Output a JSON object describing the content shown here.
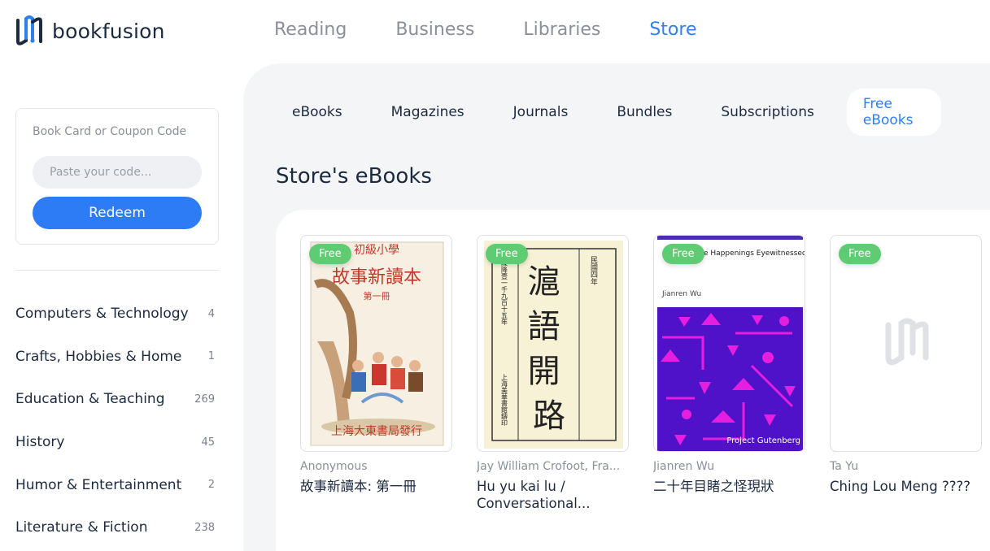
{
  "brand": {
    "name": "bookfusion"
  },
  "header": {
    "nav": [
      {
        "label": "Reading",
        "active": false
      },
      {
        "label": "Business",
        "active": false
      },
      {
        "label": "Libraries",
        "active": false
      },
      {
        "label": "Store",
        "active": true
      }
    ]
  },
  "sidebar": {
    "coupon": {
      "title": "Book Card or Coupon Code",
      "placeholder": "Paste your code...",
      "button": "Redeem"
    },
    "categories": [
      {
        "label": "Computers & Technology",
        "count": "4"
      },
      {
        "label": "Crafts, Hobbies & Home",
        "count": "1"
      },
      {
        "label": "Education & Teaching",
        "count": "269"
      },
      {
        "label": "History",
        "count": "45"
      },
      {
        "label": "Humor & Entertainment",
        "count": "2"
      },
      {
        "label": "Literature & Fiction",
        "count": "238"
      }
    ]
  },
  "store": {
    "tabs": [
      {
        "label": "eBooks",
        "active": false
      },
      {
        "label": "Magazines",
        "active": false
      },
      {
        "label": "Journals",
        "active": false
      },
      {
        "label": "Bundles",
        "active": false
      },
      {
        "label": "Subscriptions",
        "active": false
      },
      {
        "label": "Free eBooks",
        "active": true
      }
    ],
    "section_title": "Store's eBooks",
    "books": [
      {
        "badge": "Free",
        "author": "Anonymous",
        "title": "故事新讀本: 第一冊",
        "cover_text": {
          "top": "初級小學",
          "header": "故事新讀本",
          "vol": "第一冊",
          "publisher": "上海大東書局發行"
        }
      },
      {
        "badge": "Free",
        "author": "Jay William Crofoot, Fra...",
        "title": "Hu yu kai lu / Conversational...",
        "cover_text": {
          "big": "滬語開路",
          "side": "民國四年",
          "left_col": "陳降壹一千九百十五年",
          "left_col2": "上海美華書館鑄印"
        }
      },
      {
        "badge": "Free",
        "author": "Jianren Wu",
        "title": "二十年目睹之怪現狀",
        "cover_text": {
          "title": "Bizarre Happenings Eyewitnessed Over Two Decades",
          "author": "Jianren Wu",
          "publisher": "Project Gutenberg"
        }
      },
      {
        "badge": "Free",
        "author": "Ta Yu",
        "title": "Ching Lou Meng ????",
        "cover_text": {}
      }
    ]
  },
  "colors": {
    "accent": "#2f7ff0",
    "badge": "#5fcb72",
    "panel": "#f4f5f7"
  }
}
